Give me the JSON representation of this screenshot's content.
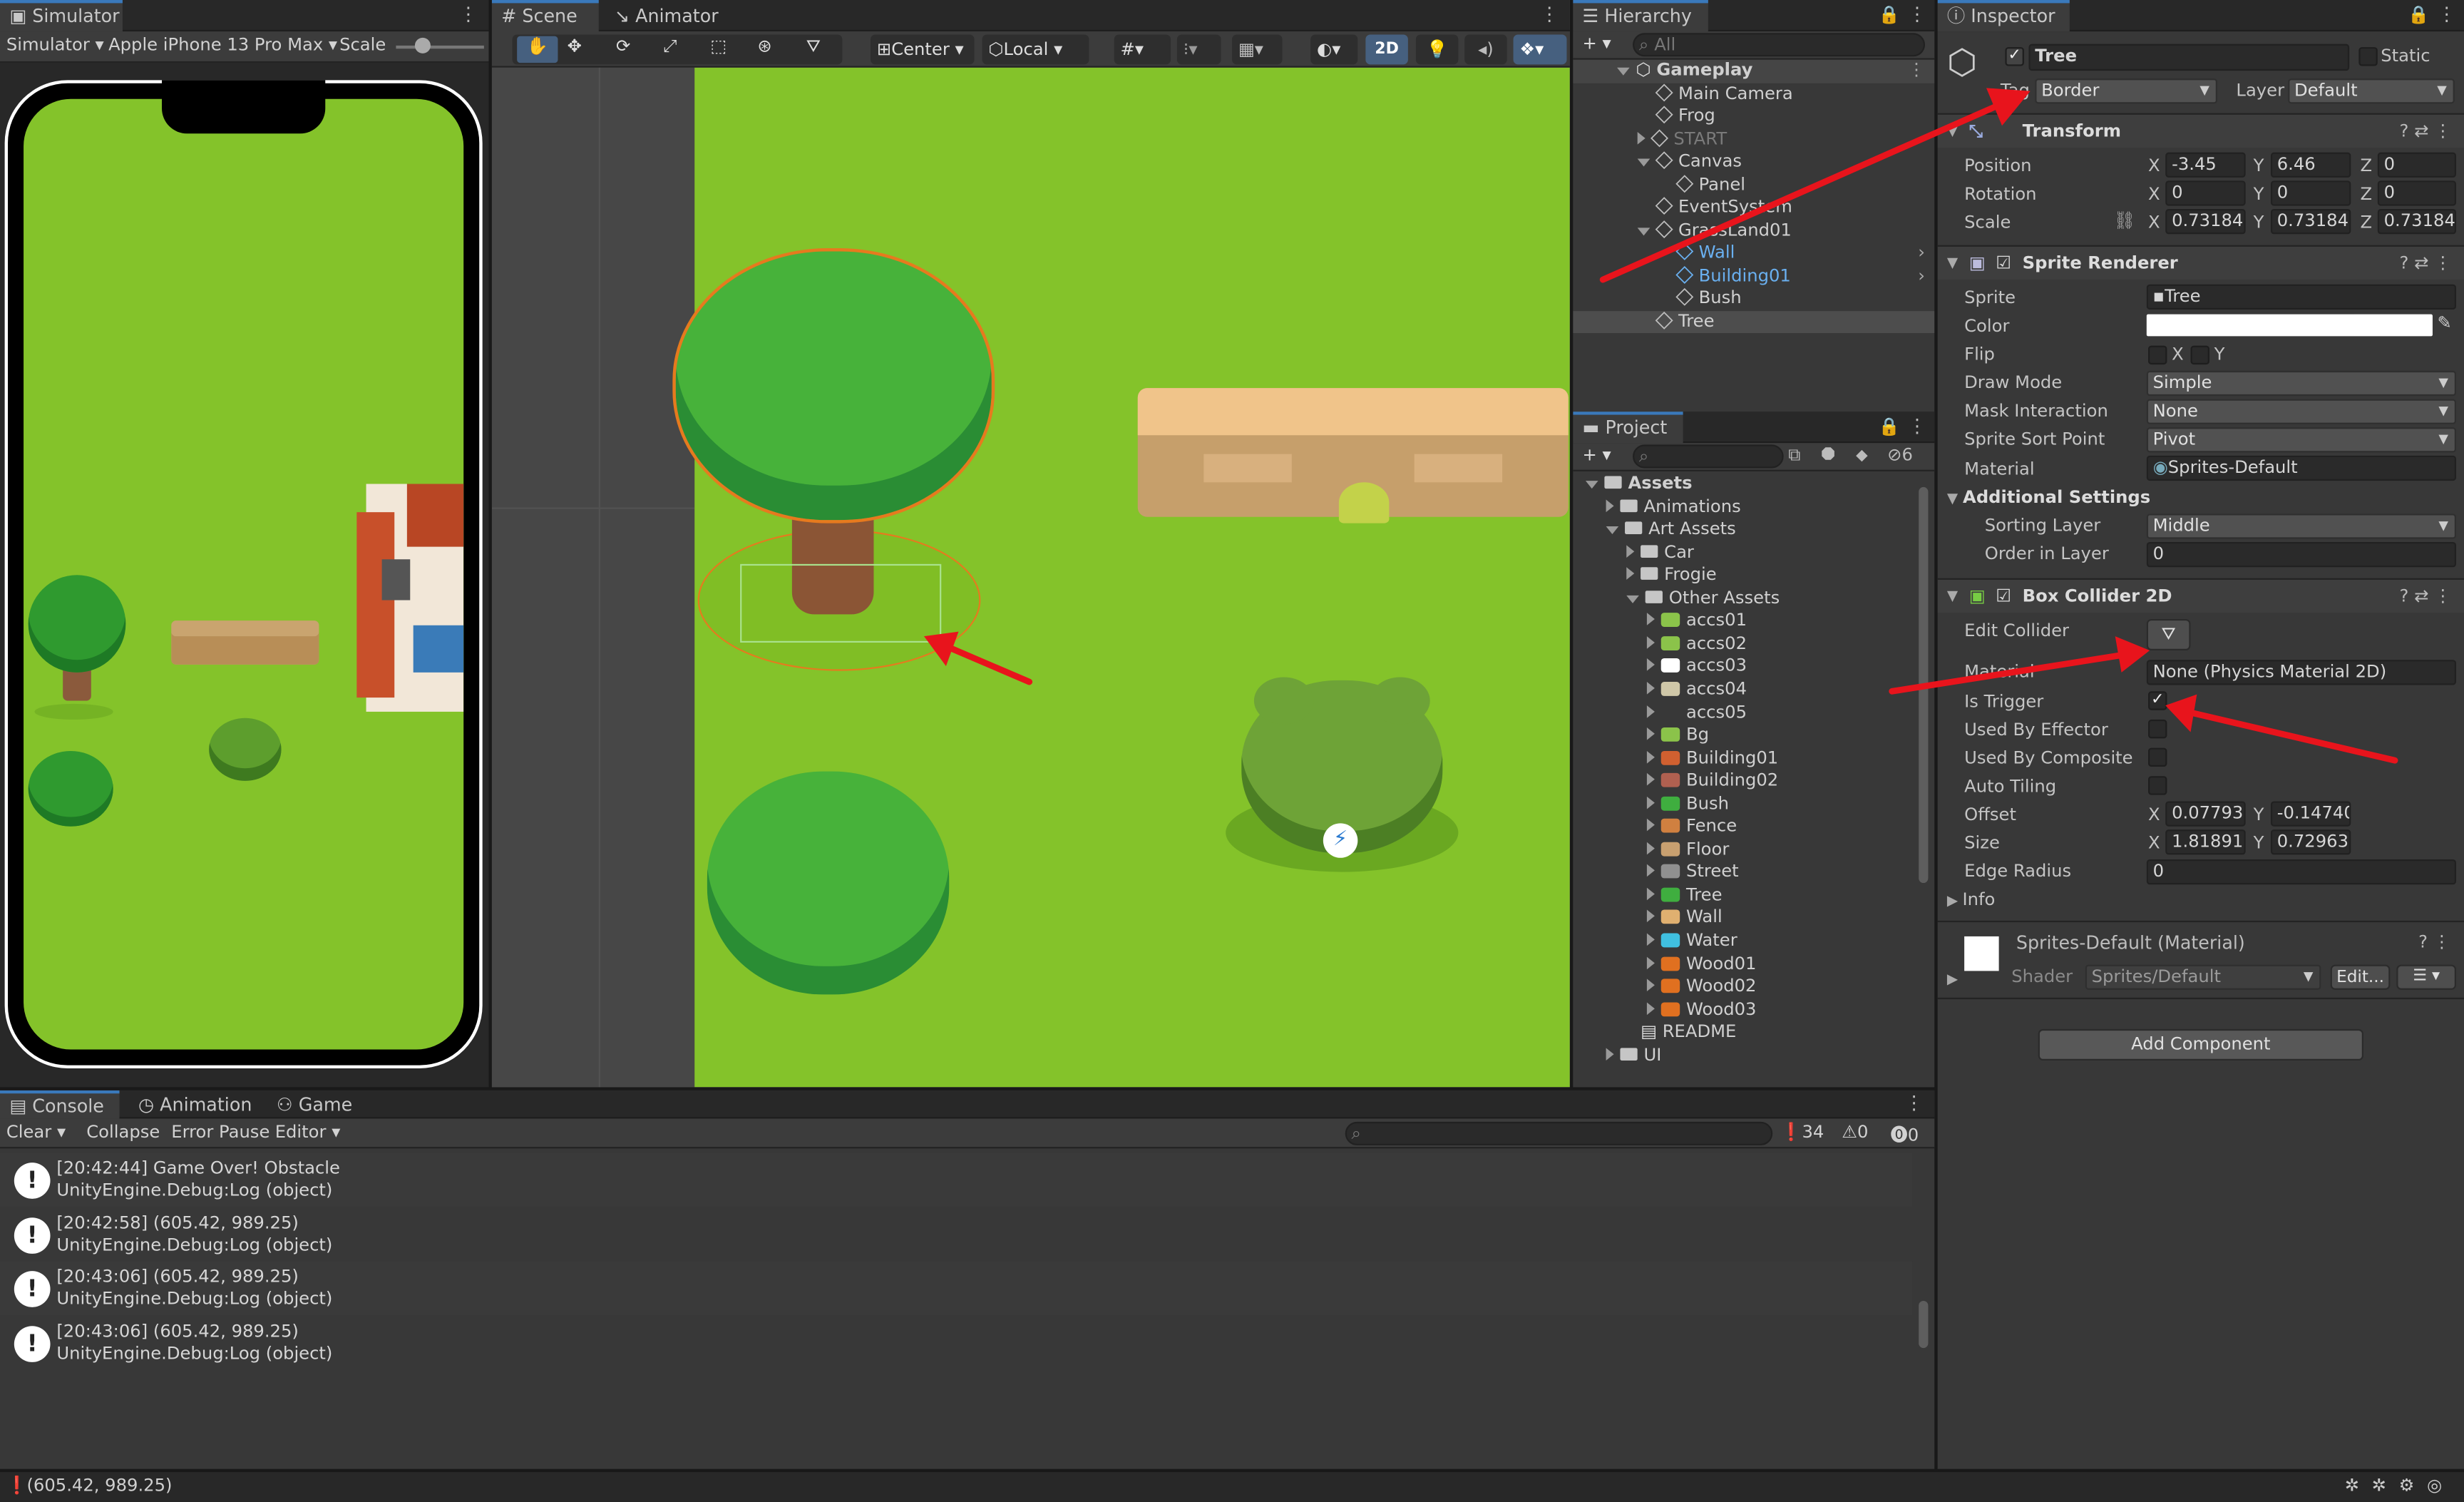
{
  "simulator": {
    "tab": "Simulator",
    "mode": "Simulator",
    "device": "Apple iPhone 13 Pro Max",
    "scale_label": "Scale"
  },
  "scene": {
    "tabs": [
      "Scene",
      "Animator"
    ],
    "pivot": "Center",
    "space": "Local",
    "mode_2d": "2D"
  },
  "hierarchy": {
    "tab": "Hierarchy",
    "search_placeholder": "All",
    "items": [
      {
        "label": "Gameplay",
        "depth": 0,
        "expanded": true,
        "bold": true,
        "kind": "scene"
      },
      {
        "label": "Main Camera",
        "depth": 1,
        "kind": "obj"
      },
      {
        "label": "Frog",
        "depth": 1,
        "kind": "obj"
      },
      {
        "label": "START",
        "depth": 1,
        "kind": "obj",
        "dim": true,
        "collapsed": true
      },
      {
        "label": "Canvas",
        "depth": 1,
        "kind": "obj",
        "expanded": true
      },
      {
        "label": "Panel",
        "depth": 2,
        "kind": "obj"
      },
      {
        "label": "EventSystem",
        "depth": 1,
        "kind": "obj"
      },
      {
        "label": "GrassLand01",
        "depth": 1,
        "kind": "obj",
        "expanded": true
      },
      {
        "label": "Wall",
        "depth": 2,
        "kind": "prefab",
        "blue": true,
        "chev": true
      },
      {
        "label": "Building01",
        "depth": 2,
        "kind": "prefab",
        "blue": true,
        "chev": true
      },
      {
        "label": "Bush",
        "depth": 2,
        "kind": "obj"
      },
      {
        "label": "Tree",
        "depth": 1,
        "kind": "obj",
        "selected": true
      }
    ]
  },
  "project": {
    "tab": "Project",
    "hidden_count": "6",
    "items": [
      {
        "label": "Assets",
        "depth": 0,
        "folder": true,
        "expanded": true,
        "bold": true
      },
      {
        "label": "Animations",
        "depth": 1,
        "folder": true
      },
      {
        "label": "Art Assets",
        "depth": 1,
        "folder": true,
        "expanded": true
      },
      {
        "label": "Car",
        "depth": 2,
        "folder": true
      },
      {
        "label": "Frogie",
        "depth": 2,
        "folder": true
      },
      {
        "label": "Other Assets",
        "depth": 2,
        "folder": true,
        "expanded": true
      },
      {
        "label": "accs01",
        "depth": 3,
        "color": "#8bc34a"
      },
      {
        "label": "accs02",
        "depth": 3,
        "color": "#8bc34a"
      },
      {
        "label": "accs03",
        "depth": 3,
        "color": "#ffffff"
      },
      {
        "label": "accs04",
        "depth": 3,
        "color": "#cfc7a8"
      },
      {
        "label": "accs05",
        "depth": 3,
        "color": ""
      },
      {
        "label": "Bg",
        "depth": 3,
        "color": "#8bc34a"
      },
      {
        "label": "Building01",
        "depth": 3,
        "color": "#d06030"
      },
      {
        "label": "Building02",
        "depth": 3,
        "color": "#b06050"
      },
      {
        "label": "Bush",
        "depth": 3,
        "color": "#3fae3f"
      },
      {
        "label": "Fence",
        "depth": 3,
        "color": "#d08040"
      },
      {
        "label": "Floor",
        "depth": 3,
        "color": "#c8a070"
      },
      {
        "label": "Street",
        "depth": 3,
        "color": "#909090"
      },
      {
        "label": "Tree",
        "depth": 3,
        "color": "#3fae3f"
      },
      {
        "label": "Wall",
        "depth": 3,
        "color": "#e0b070"
      },
      {
        "label": "Water",
        "depth": 3,
        "color": "#40c0e0"
      },
      {
        "label": "Wood01",
        "depth": 3,
        "color": "#e07020"
      },
      {
        "label": "Wood02",
        "depth": 3,
        "color": "#e07020"
      },
      {
        "label": "Wood03",
        "depth": 3,
        "color": "#e07020"
      },
      {
        "label": "README",
        "depth": 2,
        "color": "",
        "doc": true
      },
      {
        "label": "UI",
        "depth": 1,
        "folder": true
      }
    ]
  },
  "inspector": {
    "tab": "Inspector",
    "object_name": "Tree",
    "static_label": "Static",
    "tag_label": "Tag",
    "tag_value": "Border",
    "layer_label": "Layer",
    "layer_value": "Default",
    "transform": {
      "title": "Transform",
      "position": {
        "label": "Position",
        "x": "-3.45",
        "y": "6.46",
        "z": "0"
      },
      "rotation": {
        "label": "Rotation",
        "x": "0",
        "y": "0",
        "z": "0"
      },
      "scale": {
        "label": "Scale",
        "x": "0.73184",
        "y": "0.73184",
        "z": "0.73184"
      }
    },
    "sprite_renderer": {
      "title": "Sprite Renderer",
      "sprite": {
        "label": "Sprite",
        "value": "Tree"
      },
      "color": {
        "label": "Color",
        "value": "#ffffff"
      },
      "flip": {
        "label": "Flip",
        "x": "X",
        "y": "Y"
      },
      "draw_mode": {
        "label": "Draw Mode",
        "value": "Simple"
      },
      "mask": {
        "label": "Mask Interaction",
        "value": "None"
      },
      "sort_point": {
        "label": "Sprite Sort Point",
        "value": "Pivot"
      },
      "material": {
        "label": "Material",
        "value": "Sprites-Default"
      },
      "additional": "Additional Settings",
      "sorting_layer": {
        "label": "Sorting Layer",
        "value": "Middle"
      },
      "order": {
        "label": "Order in Layer",
        "value": "0"
      }
    },
    "box_collider": {
      "title": "Box Collider 2D",
      "edit_collider": "Edit Collider",
      "material": {
        "label": "Material",
        "value": "None (Physics Material 2D)"
      },
      "is_trigger": {
        "label": "Is Trigger",
        "checked": true
      },
      "effector": "Used By Effector",
      "composite": "Used By Composite",
      "tiling": "Auto Tiling",
      "offset": {
        "label": "Offset",
        "x": "0.07793",
        "y": "-0.14740"
      },
      "size": {
        "label": "Size",
        "x": "1.818919",
        "y": "0.72963"
      },
      "edge": {
        "label": "Edge Radius",
        "value": "0"
      },
      "info": "Info"
    },
    "material_card": {
      "name": "Sprites-Default (Material)",
      "shader_label": "Shader",
      "shader": "Sprites/Default",
      "edit": "Edit..."
    },
    "add_component": "Add Component"
  },
  "console": {
    "tabs": [
      "Console",
      "Animation",
      "Game"
    ],
    "clear": "Clear",
    "collapse": "Collapse",
    "error_pause": "Error Pause",
    "editor": "Editor",
    "counts": {
      "info": "34",
      "warn": "0",
      "error": "0"
    },
    "logs": [
      {
        "l1": "[20:42:44] Game Over! Obstacle",
        "l2": "UnityEngine.Debug:Log (object)"
      },
      {
        "l1": "[20:42:58] (605.42, 989.25)",
        "l2": "UnityEngine.Debug:Log (object)"
      },
      {
        "l1": "[20:43:06] (605.42, 989.25)",
        "l2": "UnityEngine.Debug:Log (object)"
      },
      {
        "l1": "[20:43:06] (605.42, 989.25)",
        "l2": "UnityEngine.Debug:Log (object)"
      }
    ]
  },
  "status": {
    "text": "(605.42, 989.25)"
  },
  "colors": {
    "grass": "#84c32a",
    "accent": "#3a79bb",
    "annotation": "#e8141c"
  }
}
